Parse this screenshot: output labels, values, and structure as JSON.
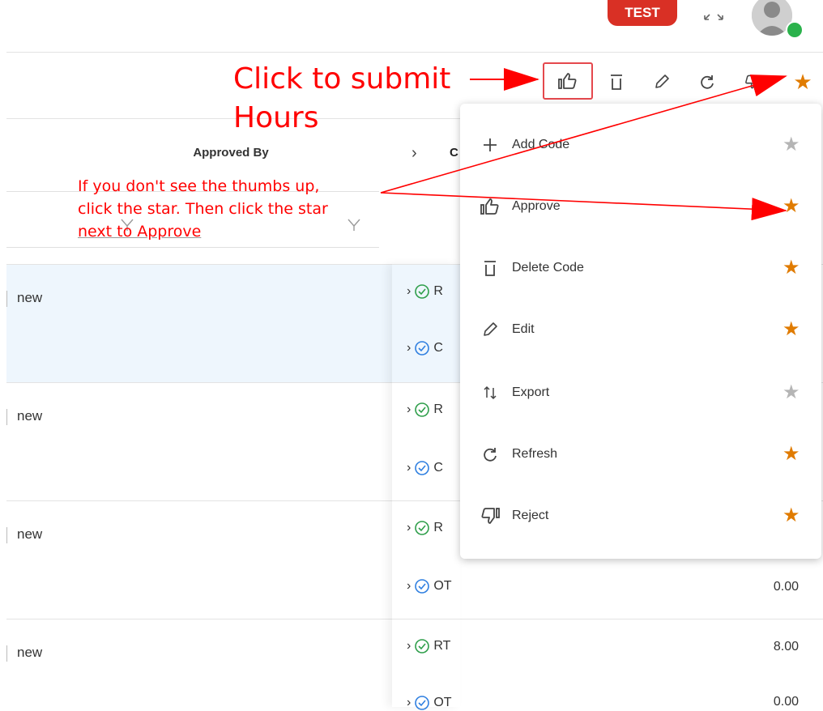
{
  "header": {
    "env_badge": "TEST",
    "expand_icon": "expand-arrows-icon",
    "avatar_icon": "user-avatar-icon"
  },
  "toolbar": {
    "buttons": [
      "thumbs-up-icon",
      "trash-icon",
      "pencil-icon",
      "refresh-icon",
      "thumbs-down-icon",
      "star-icon"
    ]
  },
  "table": {
    "column_header": "Approved By",
    "next_column_initial": "C",
    "rows": [
      {
        "status": "new",
        "sub": [
          {
            "code": "R",
            "value": ""
          },
          {
            "code": "C",
            "value": ""
          }
        ]
      },
      {
        "status": "new",
        "sub": [
          {
            "code": "R",
            "value": ""
          },
          {
            "code": "C",
            "value": ""
          }
        ]
      },
      {
        "status": "new",
        "sub": [
          {
            "code": "R",
            "value": ""
          },
          {
            "code": "OT",
            "value": "0.00"
          }
        ]
      },
      {
        "status": "new",
        "sub": [
          {
            "code": "RT",
            "value": "8.00"
          },
          {
            "code": "OT",
            "value": "0.00"
          }
        ]
      }
    ]
  },
  "menu": {
    "items": [
      {
        "label": "Add Code",
        "icon": "plus-icon",
        "starred": false
      },
      {
        "label": "Approve",
        "icon": "thumbs-up-icon",
        "starred": true
      },
      {
        "label": "Delete Code",
        "icon": "trash-icon",
        "starred": true
      },
      {
        "label": "Edit",
        "icon": "pencil-icon",
        "starred": true
      },
      {
        "label": "Export",
        "icon": "export-arrows-icon",
        "starred": false
      },
      {
        "label": "Refresh",
        "icon": "refresh-icon",
        "starred": true
      },
      {
        "label": "Reject",
        "icon": "thumbs-down-icon",
        "starred": true
      }
    ]
  },
  "annotations": {
    "submit_line1": "Click to submit",
    "submit_line2": "Hours",
    "hint_line1": "If you don't see the thumbs up,",
    "hint_line2": "click the star. Then click the star",
    "hint_line3": "next to Approve"
  },
  "colors": {
    "star_active": "#e07b00",
    "star_inactive": "#b5b5b5",
    "annotation": "#ff0000",
    "check_green": "#2e9e4a",
    "check_blue": "#2f7fe0"
  }
}
